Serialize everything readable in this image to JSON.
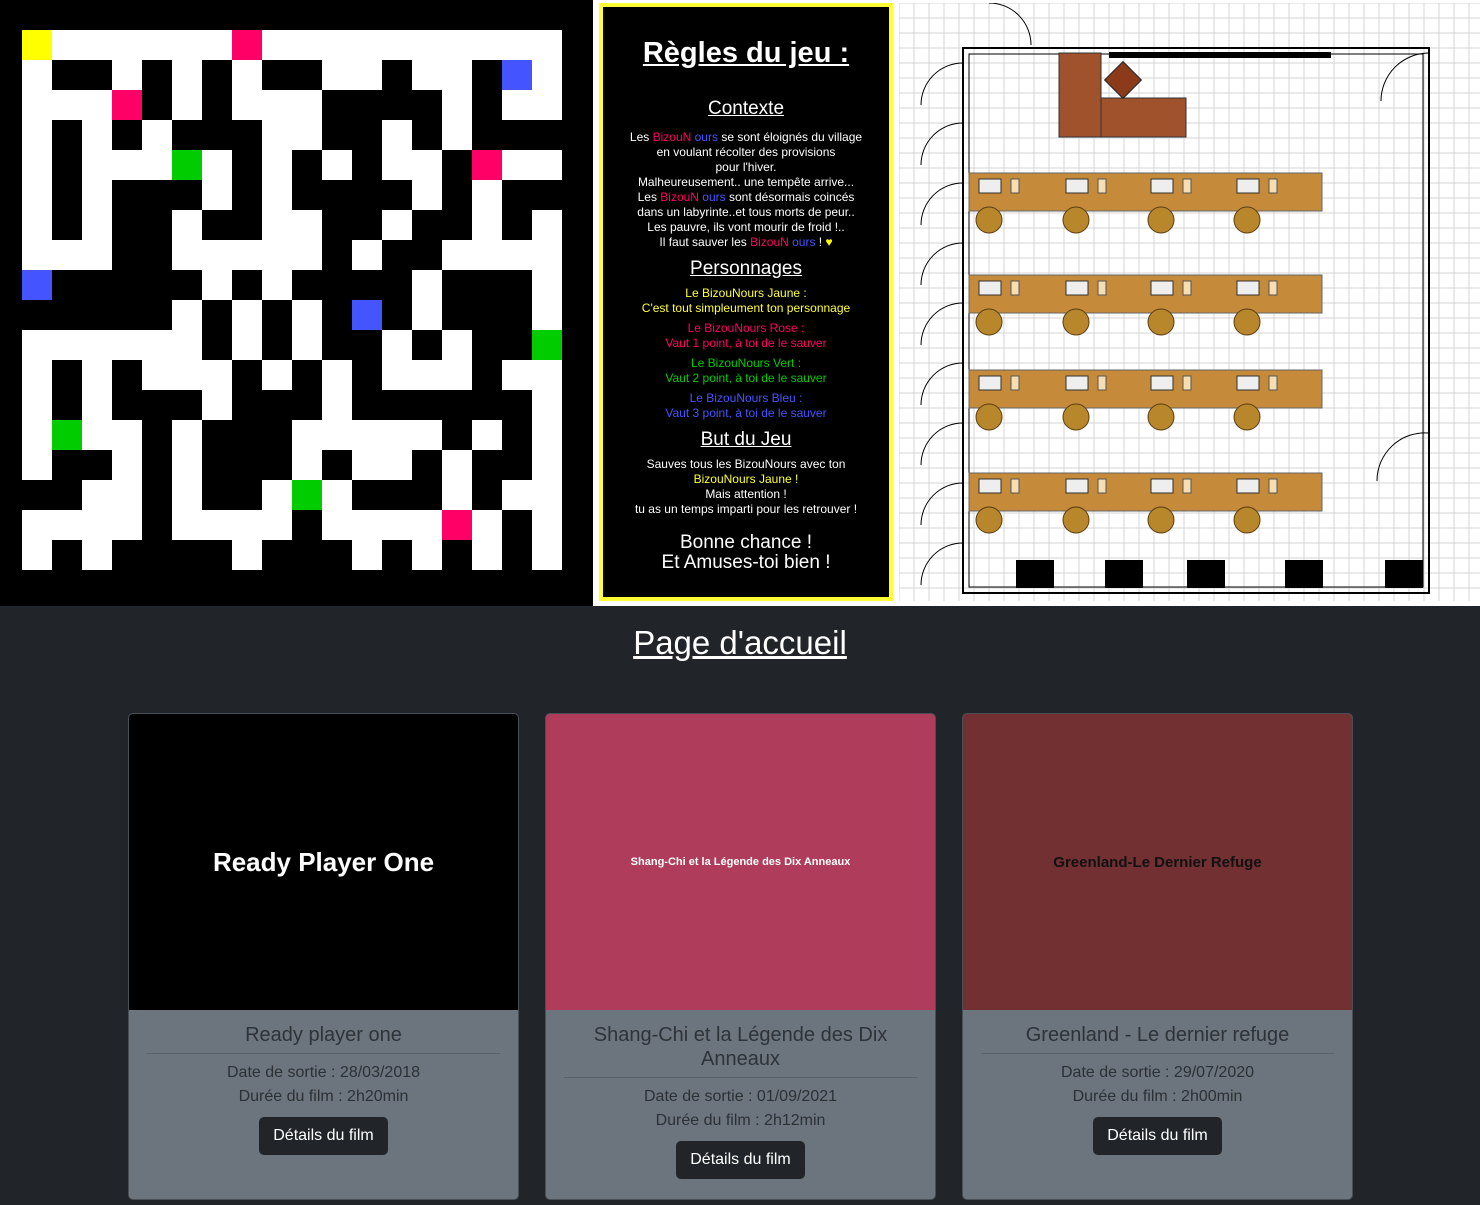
{
  "rules": {
    "title": "Règles du jeu :",
    "context_heading": "Contexte",
    "ctx1_pre": "Les ",
    "ctx1_post": "  se sont éloignés du village",
    "ctx2": "en voulant récolter des provisions",
    "ctx3": "pour l'hiver.",
    "ctx4": "Malheureusement.. une tempête arrive...",
    "ctx5_pre": "Les ",
    "ctx5_post": "  sont désormais coincés",
    "ctx6": "dans un labyrinte..et tous morts de peur..",
    "ctx7": "Les pauvre, ils vont mourir de froid !..",
    "ctx8_pre": "Il faut sauver les ",
    "ctx8_post": "  ! ",
    "heart": "♥",
    "brand_a": "Biz",
    "brand_b": "ouN",
    "brand_c": " ours",
    "characters_heading": "Personnages",
    "yellow_name": "Le BizouNours Jaune :",
    "yellow_desc": "C'est tout simpleument ton personnage",
    "pink_name": "Le BizouNours Rose :",
    "pink_desc": "Vaut 1 point, à toi de le sauver",
    "green_name": "Le BizouNours Vert :",
    "green_desc": "Vaut 2 point, à toi de le sauver",
    "blue_name": "Le BizouNours Bleu :",
    "blue_desc": "Vaut 3 point, à toi de le sauver",
    "goal_heading": "But du Jeu",
    "goal1": "Sauves tous les BizouNours avec ton",
    "goal2": "BizouNours Jaune !",
    "goal3": "Mais attention !",
    "goal4": "tu as un temps imparti pour les retrouver !",
    "farewell1": "Bonne chance !",
    "farewell2": "Et Amuses-toi bien !"
  },
  "colors": {
    "yellow": "#ffff00",
    "pink": "#ff0066",
    "green": "#00cc00",
    "blue": "#4455ff",
    "dark_bg": "#212529"
  },
  "page": {
    "title": "Page d'accueil"
  },
  "films": [
    {
      "poster_text": "Ready Player One",
      "poster_bg": "#000000",
      "poster_color": "#ffffff",
      "title": "Ready player one",
      "release": "Date de sortie : 28/03/2018",
      "duration": "Durée du film : 2h20min",
      "button": "Détails du film"
    },
    {
      "poster_text": "Shang-Chi et la Légende des Dix Anneaux",
      "poster_bg": "#ae3c5a",
      "poster_color": "#ffffff",
      "title": "Shang-Chi et la Légende des Dix Anneaux",
      "release": "Date de sortie : 01/09/2021",
      "duration": "Durée du film : 2h12min",
      "button": "Détails du film"
    },
    {
      "poster_text": "Greenland-Le Dernier Refuge",
      "poster_bg": "#733033",
      "poster_color": "#111111",
      "title": "Greenland - Le dernier refuge",
      "release": "Date de sortie : 29/07/2020",
      "duration": "Durée du film : 2h00min",
      "button": "Détails du film"
    }
  ]
}
